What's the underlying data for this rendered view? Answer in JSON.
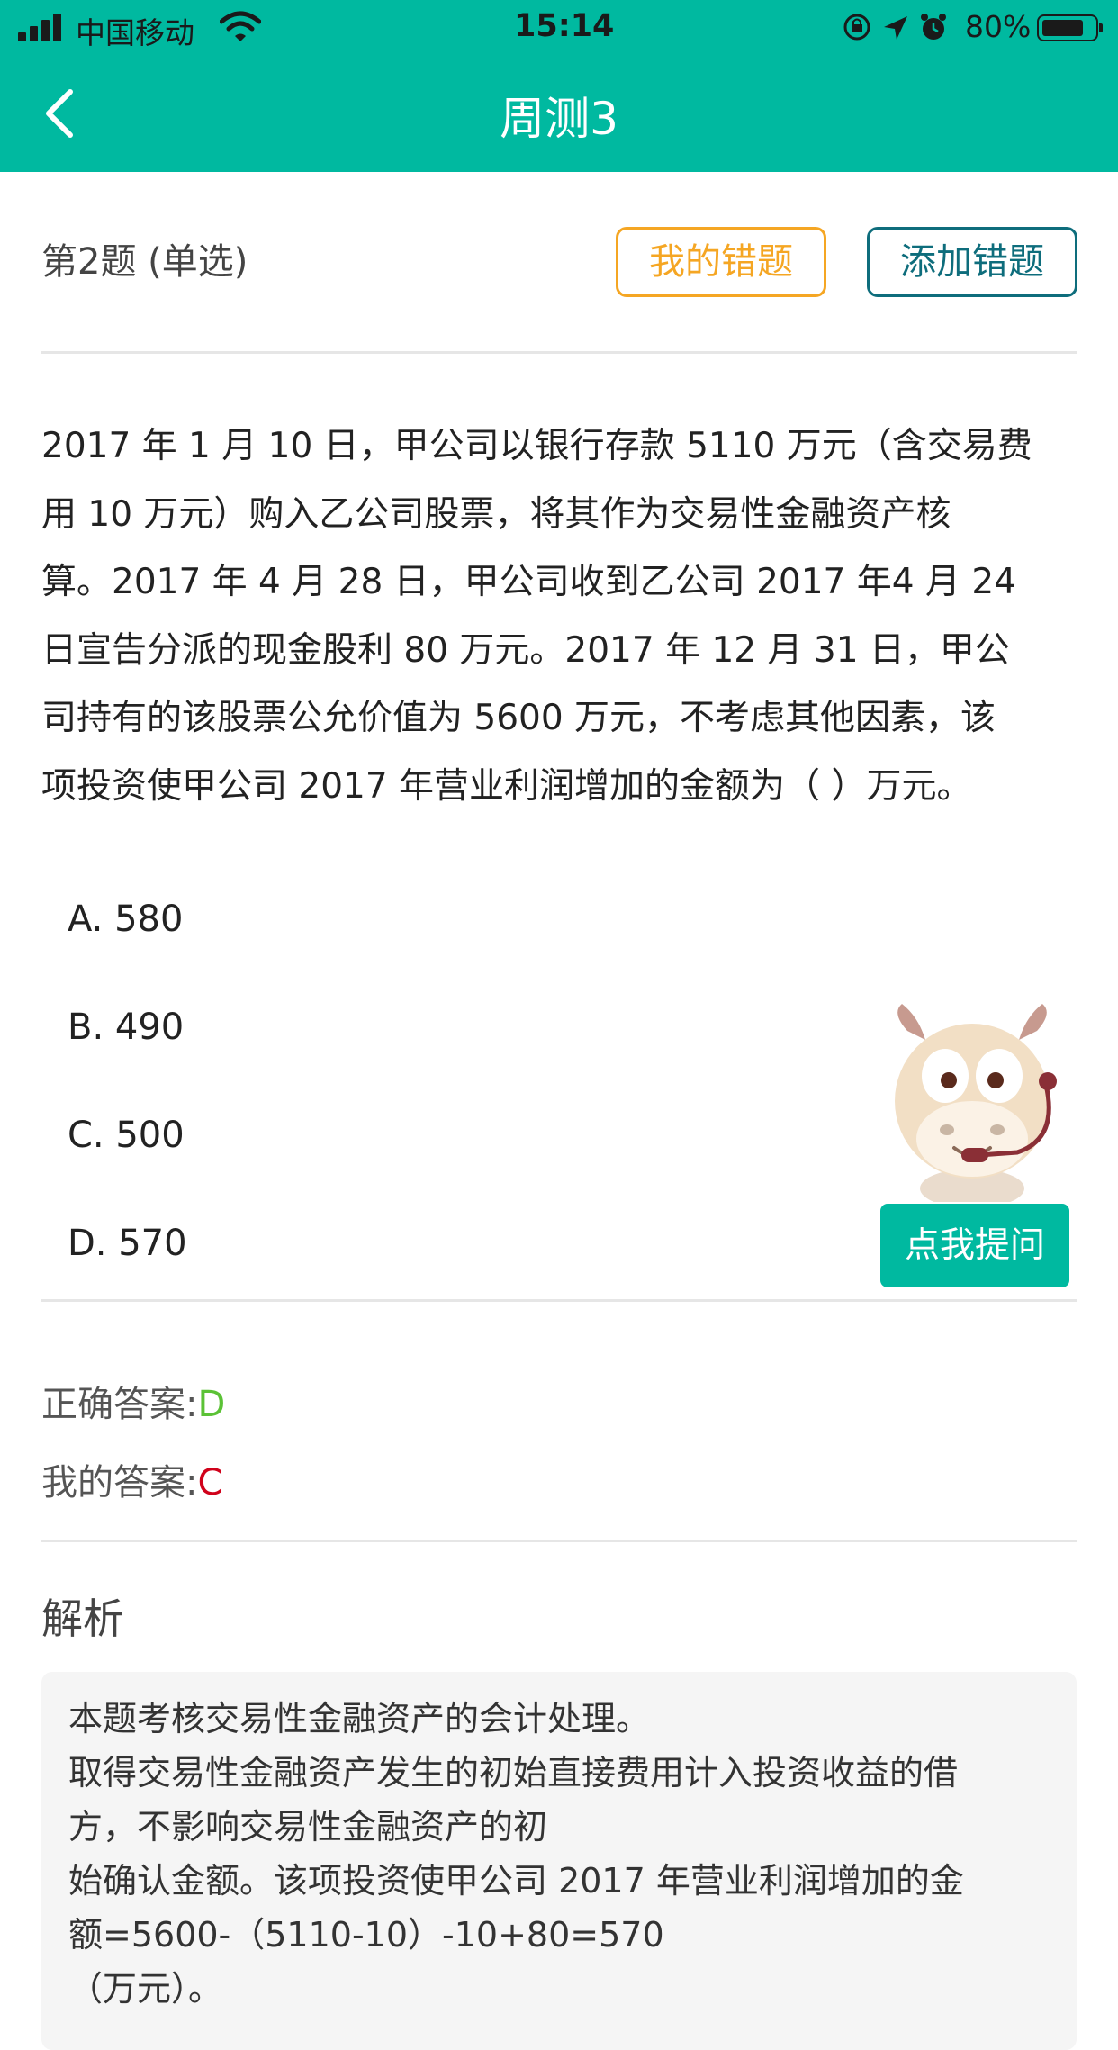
{
  "status_bar": {
    "carrier": "中国移动",
    "time": "15:14",
    "battery_percent": "80%",
    "battery_level": 0.8,
    "icons": [
      "signal-icon",
      "wifi-icon",
      "rotation-lock-icon",
      "location-icon",
      "alarm-icon",
      "battery-icon"
    ]
  },
  "nav": {
    "title": "周测3",
    "back_icon": "back-arrow-icon"
  },
  "question": {
    "header": "第2题 (单选)",
    "my_mistakes_label": "我的错题",
    "add_mistake_label": "添加错题",
    "lines": [
      "2017 年 1 月 10 日，甲公司以银行存款 5110 万元（含交易费",
      "用 10 万元）购入乙公司股票，将其作为交易性金融资产核",
      "算。2017 年 4 月 28 日，甲公司收到乙公司 2017 年4 月 24",
      "日宣告分派的现金股利 80 万元。2017 年 12 月 31 日，甲公",
      "司持有的该股票公允价值为 5600 万元，不考虑其他因素，该",
      "项投资使甲公司 2017 年营业利润增加的金额为（ ）万元。"
    ],
    "options": [
      "A. 580",
      "B. 490",
      "C. 500",
      "D. 570"
    ]
  },
  "ask_button": {
    "label": "点我提问",
    "mascot_icon": "cow-mascot-icon"
  },
  "answers": {
    "correct_label": "正确答案:",
    "correct_value": "D",
    "mine_label": "我的答案:",
    "mine_value": "C"
  },
  "analysis": {
    "title": "解析",
    "lines": [
      "本题考核交易性金融资产的会计处理。",
      "取得交易性金融资产发生的初始直接费用计入投资收益的借",
      "方，不影响交易性金融资产的初",
      "始确认金额。该项投资使甲公司 2017 年营业利润增加的金",
      "额=5600-（5110-10）-10+80=570",
      "（万元）。"
    ]
  },
  "colors": {
    "brand": "#00b9a0",
    "mistakes_orange": "#f5a623",
    "add_teal": "#0e6d7c",
    "correct_green": "#5bc236",
    "wrong_red": "#d0021b"
  }
}
